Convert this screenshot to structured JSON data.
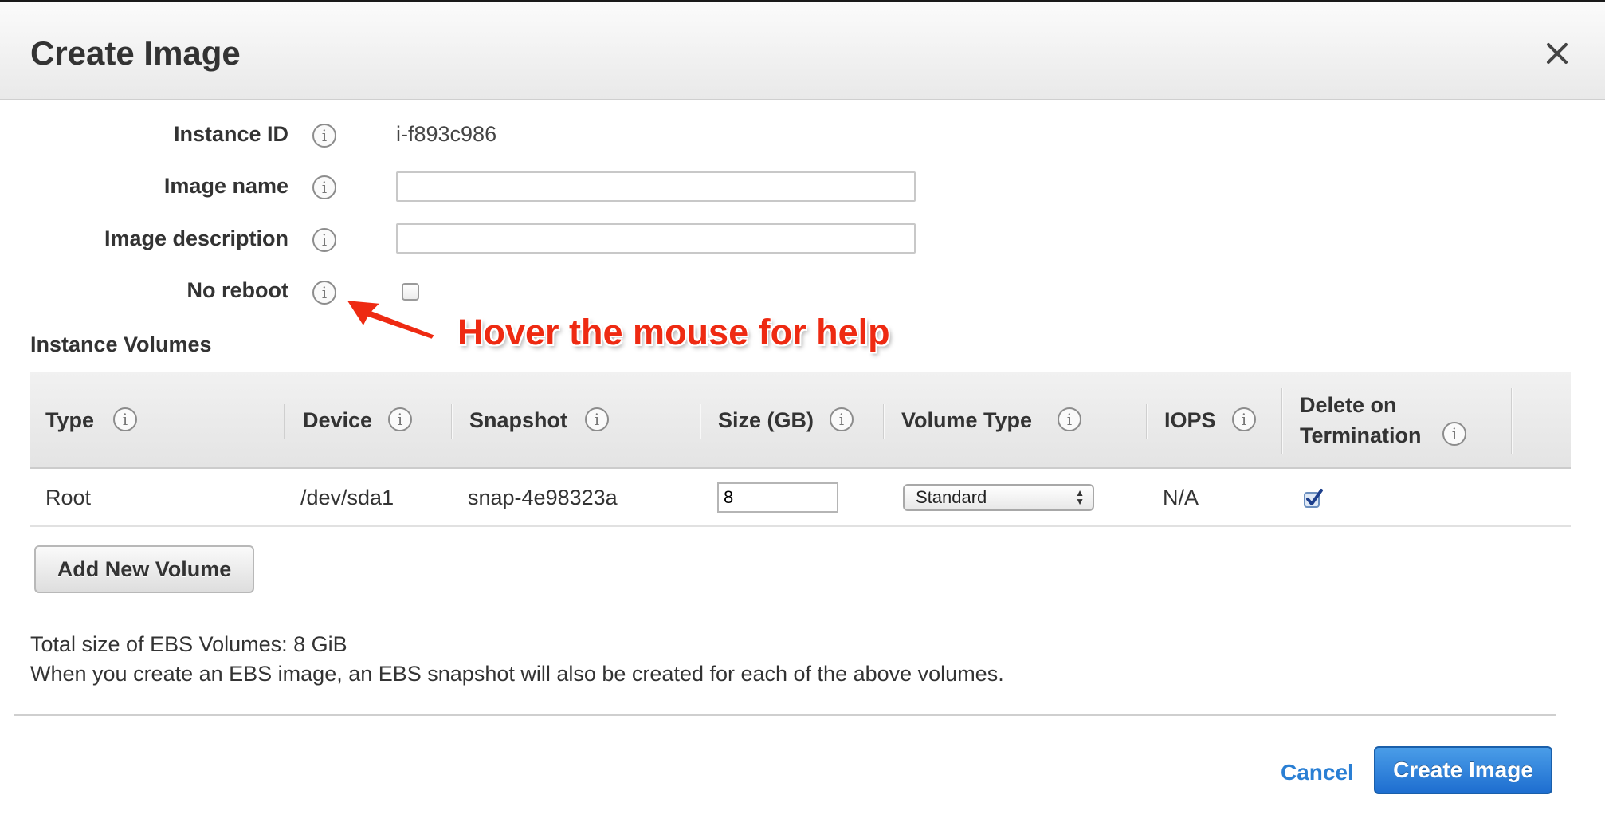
{
  "dialog": {
    "title": "Create Image",
    "close_icon": "close-icon"
  },
  "form": {
    "instance_id_label": "Instance ID",
    "instance_id_value": "i-f893c986",
    "image_name_label": "Image name",
    "image_name_value": "",
    "image_description_label": "Image description",
    "image_description_value": "",
    "no_reboot_label": "No reboot",
    "no_reboot_checked": false,
    "info_icon_glyph": "i"
  },
  "annotation": {
    "text": "Hover the mouse for help",
    "color": "#ee2a12"
  },
  "volumes": {
    "section_title": "Instance Volumes",
    "columns": [
      {
        "label": "Type"
      },
      {
        "label": "Device"
      },
      {
        "label": "Snapshot"
      },
      {
        "label": "Size (GB)"
      },
      {
        "label": "Volume Type"
      },
      {
        "label": "IOPS"
      },
      {
        "label_line1": "Delete on",
        "label_line2": "Termination"
      }
    ],
    "rows": [
      {
        "type": "Root",
        "device": "/dev/sda1",
        "snapshot": "snap-4e98323a",
        "size": "8",
        "volume_type": "Standard",
        "iops": "N/A",
        "delete_on_termination": true
      }
    ],
    "add_button_label": "Add New Volume"
  },
  "summary": {
    "total_text": "Total size of EBS Volumes: 8 GiB",
    "note_text": "When you create an EBS image, an EBS snapshot will also be created for each of the above volumes."
  },
  "footer": {
    "cancel_label": "Cancel",
    "create_label": "Create Image",
    "accent_color": "#2a7fd4"
  }
}
